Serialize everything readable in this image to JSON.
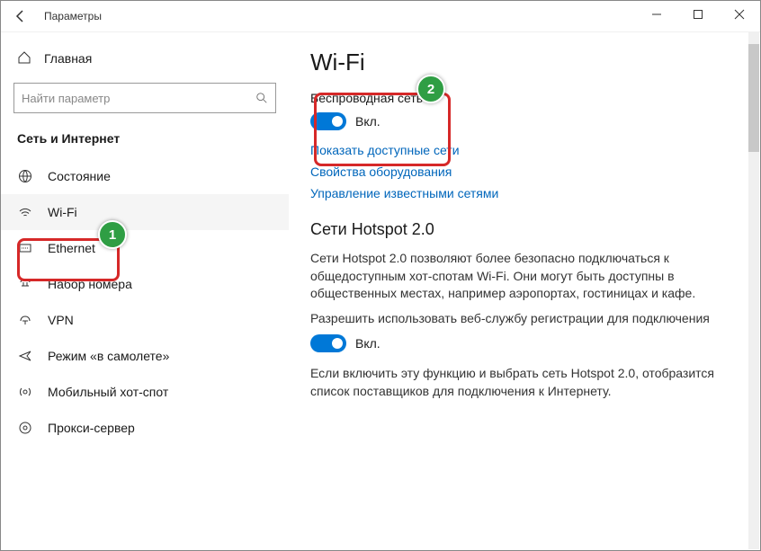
{
  "titlebar": {
    "title": "Параметры"
  },
  "sidebar": {
    "home": "Главная",
    "search_placeholder": "Найти параметр",
    "section": "Сеть и Интернет",
    "items": [
      {
        "label": "Состояние"
      },
      {
        "label": "Wi-Fi"
      },
      {
        "label": "Ethernet"
      },
      {
        "label": "Набор номера"
      },
      {
        "label": "VPN"
      },
      {
        "label": "Режим «в самолете»"
      },
      {
        "label": "Мобильный хот-спот"
      },
      {
        "label": "Прокси-сервер"
      }
    ]
  },
  "main": {
    "h1": "Wi-Fi",
    "wireless": {
      "label": "Беспроводная сеть",
      "state": "Вкл."
    },
    "links": {
      "show": "Показать доступные сети",
      "hw": "Свойства оборудования",
      "manage": "Управление известными сетями"
    },
    "hotspot": {
      "h": "Сети Hotspot 2.0",
      "p1": "Сети Hotspot 2.0 позволяют более безопасно подключаться к общедоступным хот-спотам Wi-Fi. Они могут быть доступны в общественных местах, например аэропортах, гостиницах и кафе.",
      "p2": "Разрешить использовать веб-службу регистрации для подключения",
      "state": "Вкл.",
      "p3": "Если включить эту функцию и выбрать сеть Hotspot 2.0, отобразится список поставщиков для подключения к Интернету."
    }
  },
  "annotations": {
    "b1": "1",
    "b2": "2"
  }
}
